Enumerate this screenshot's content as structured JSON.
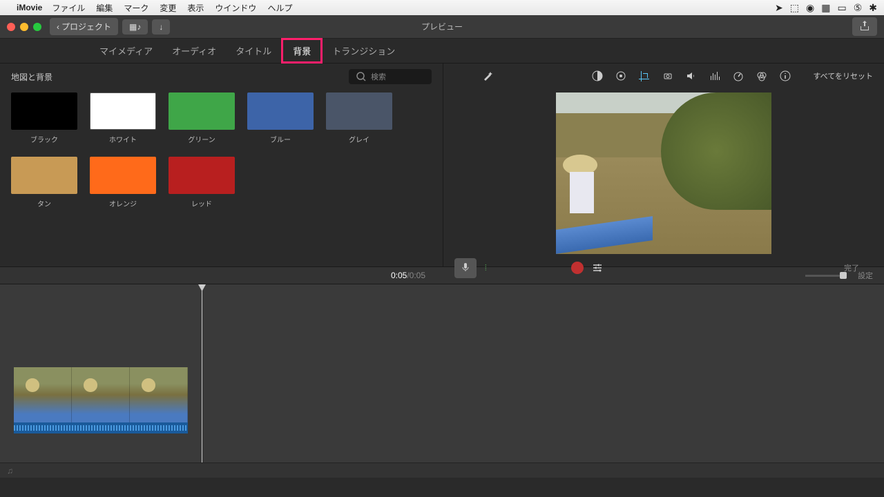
{
  "menubar": {
    "app": "iMovie",
    "items": [
      "ファイル",
      "編集",
      "マーク",
      "変更",
      "表示",
      "ウインドウ",
      "ヘルプ"
    ]
  },
  "titlebar": {
    "back": "プロジェクト",
    "title": "プレビュー"
  },
  "tabs": [
    "マイメディア",
    "オーディオ",
    "タイトル",
    "背景",
    "トランジション"
  ],
  "browser": {
    "title": "地図と背景",
    "search_placeholder": "検索",
    "swatches": [
      {
        "label": "ブラック",
        "color": "#000000"
      },
      {
        "label": "ホワイト",
        "color": "#ffffff"
      },
      {
        "label": "グリーン",
        "color": "#3fa648"
      },
      {
        "label": "ブルー",
        "color": "#3d64a8"
      },
      {
        "label": "グレイ",
        "color": "#4a5568"
      },
      {
        "label": "タン",
        "color": "#c89a55"
      },
      {
        "label": "オレンジ",
        "color": "#ff6a1a"
      },
      {
        "label": "レッド",
        "color": "#b81f1f"
      }
    ]
  },
  "viewer": {
    "reset": "すべてをリセット",
    "done": "完了"
  },
  "time": {
    "current": "0:05",
    "sep": " / ",
    "total": "0:05",
    "settings": "設定"
  }
}
